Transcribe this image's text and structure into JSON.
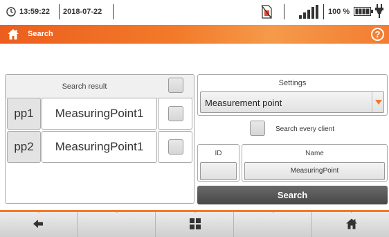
{
  "status_bar": {
    "time": "13:59:22",
    "date": "2018-07-22",
    "battery_percent": "100 %",
    "battery_level": 1.0,
    "signal_bars": 4
  },
  "title_bar": {
    "title": "Search",
    "help_label": "?",
    "accent_color": "#f27a2a"
  },
  "search_result": {
    "header": "Search result",
    "rows": [
      {
        "id": "pp1",
        "name": "MeasuringPoint1",
        "checked": false
      },
      {
        "id": "pp2",
        "name": "MeasuringPoint1",
        "checked": false
      }
    ]
  },
  "settings": {
    "label": "Settings",
    "selected": "Measurement point",
    "search_every_client_label": "Search every client",
    "search_every_client_checked": false
  },
  "filter": {
    "id_label": "ID",
    "id_value": "",
    "name_label": "Name",
    "name_value": "MeasuringPoint"
  },
  "search_button": {
    "label": "Search"
  },
  "bottom_bar": {
    "buttons": [
      "back-arrow-icon",
      "",
      "grid-icon",
      "",
      "home-icon"
    ]
  }
}
